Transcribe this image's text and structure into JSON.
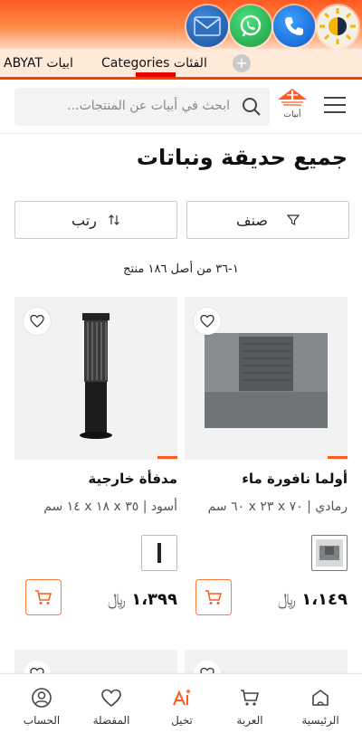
{
  "topbar": {
    "icons": [
      "mail-icon",
      "whatsapp-icon",
      "phone-icon",
      "theme-toggle-icon"
    ]
  },
  "tabs": {
    "abyat": "ABYAT ابيات",
    "categories": "Categories الفئات"
  },
  "header": {
    "search_placeholder": "ابحث في أبيات عن المنتجات...",
    "logo_text": "أبيات"
  },
  "page": {
    "title": "جميع حديقة ونباتات",
    "filter_label": "صنف",
    "sort_label": "رتب",
    "result_count": "١-٣٦ من أصل ١٨٦ منتج"
  },
  "products": [
    {
      "name": "أولما نافورة ماء",
      "spec": "رمادي | ٧٠ x ٢٣ x ٦٠ سم",
      "price": "١،١٤٩",
      "currency": "﷼"
    },
    {
      "name": "مدفأة خارجية",
      "spec": "أسود | ٣٥ x ١٨ x ١٤ سم",
      "price": "١،٣٩٩",
      "currency": "﷼"
    }
  ],
  "bottom_nav": [
    {
      "label": "الرئيسية",
      "icon": "home-icon"
    },
    {
      "label": "العربة",
      "icon": "cart-icon"
    },
    {
      "label": "تخيل",
      "icon": "ai-icon"
    },
    {
      "label": "المفضلة",
      "icon": "heart-icon"
    },
    {
      "label": "الحساب",
      "icon": "account-icon"
    }
  ],
  "colors": {
    "accent": "#ff5a1f",
    "tab_bg": "#ffe9d8",
    "underline": "#ff3d00"
  }
}
